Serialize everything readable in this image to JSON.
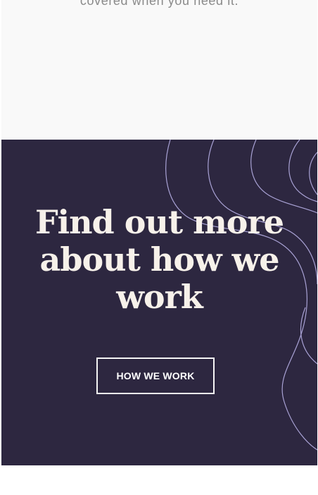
{
  "intro": {
    "text": "covered when you need it."
  },
  "cta": {
    "heading": "Find out more about how we work",
    "button_label": "HOW WE WORK",
    "background_color": "#2d2740",
    "contour_color": "#b7b0e6",
    "decoration": "topographic-contour-lines"
  }
}
